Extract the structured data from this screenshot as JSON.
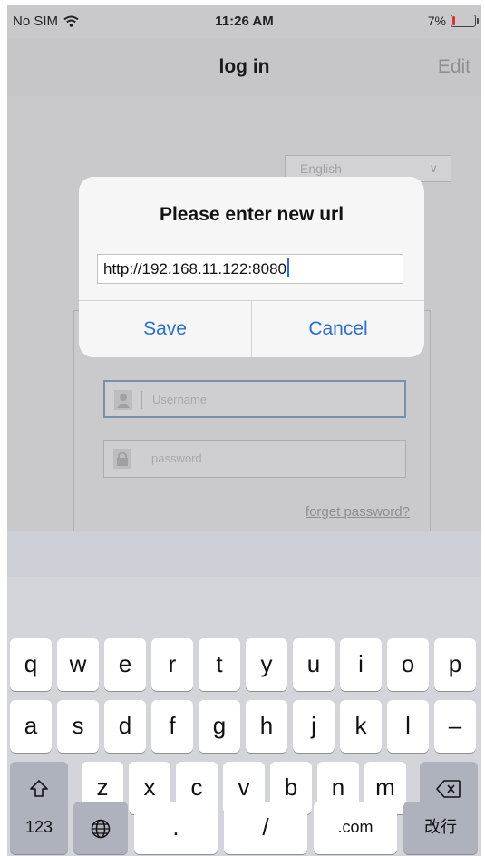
{
  "status_bar": {
    "carrier": "No SIM",
    "time": "11:26 AM",
    "battery": "7%"
  },
  "nav": {
    "title": "log in",
    "edit_label": "Edit"
  },
  "form": {
    "language": "English",
    "username_placeholder": "Username",
    "password_placeholder": "password",
    "forget_label": "forget password?"
  },
  "alert": {
    "title": "Please enter new url",
    "input_value": "http://192.168.11.122:8080",
    "save_label": "Save",
    "cancel_label": "Cancel"
  },
  "keyboard": {
    "row1": [
      "q",
      "w",
      "e",
      "r",
      "t",
      "y",
      "u",
      "i",
      "o",
      "p"
    ],
    "row2": [
      "a",
      "s",
      "d",
      "f",
      "g",
      "h",
      "j",
      "k",
      "l",
      "–"
    ],
    "row3": [
      "z",
      "x",
      "c",
      "v",
      "b",
      "n",
      "m"
    ],
    "row4": {
      "numbers": "123",
      "dot": ".",
      "slash": "/",
      "dotcom": ".com",
      "return": "改行"
    },
    "icons": {
      "shift": "shift-icon",
      "backspace": "backspace-icon",
      "globe": "globe-icon"
    }
  },
  "colors": {
    "accent": "#2d6fcb",
    "battery_low": "#e0342c"
  }
}
